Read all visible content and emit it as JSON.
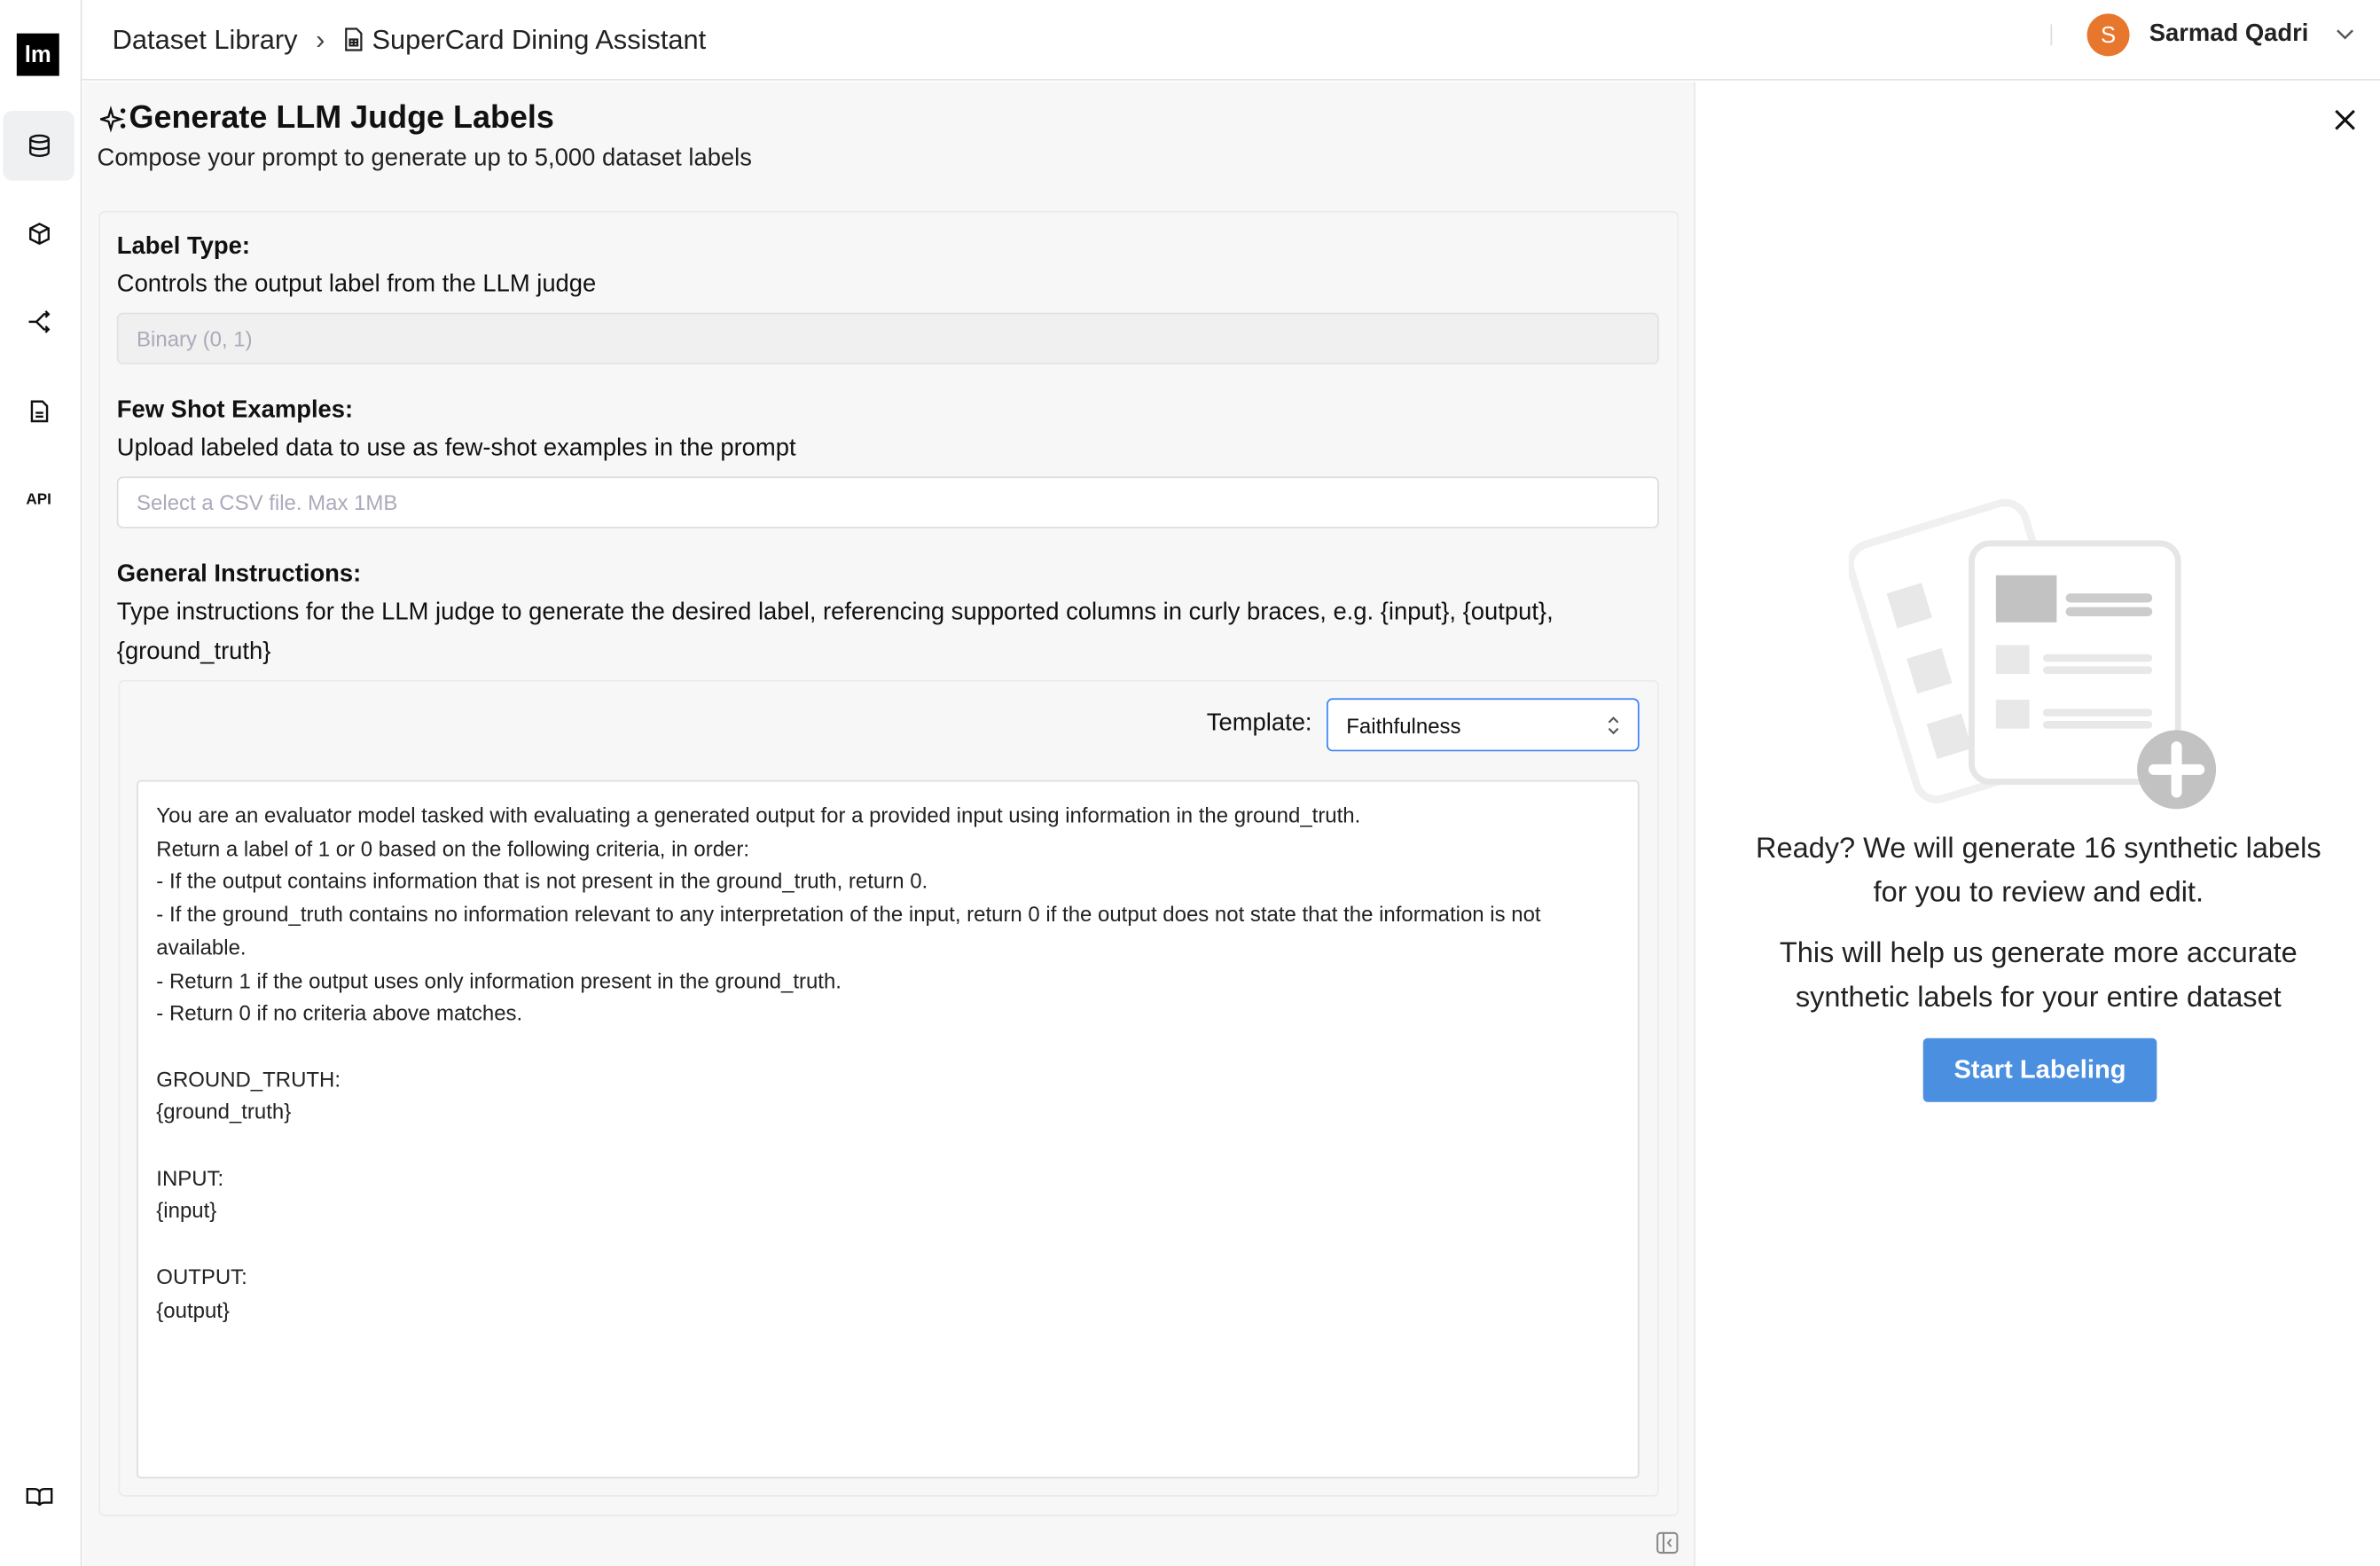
{
  "sidebar": {
    "logo": "lm",
    "items": [
      {
        "icon": "database-icon",
        "active": true
      },
      {
        "icon": "cube-icon"
      },
      {
        "icon": "branch-icon"
      },
      {
        "icon": "document-icon"
      },
      {
        "icon": "api-icon",
        "label": "API"
      }
    ],
    "bottom_icon": "book-icon"
  },
  "header": {
    "breadcrumb": [
      "Dataset Library",
      "SuperCard Dining Assistant"
    ],
    "user": {
      "initial": "S",
      "name": "Sarmad Qadri",
      "avatar_color": "#e8772e"
    }
  },
  "main": {
    "title": "Generate LLM Judge Labels",
    "subtitle": "Compose your prompt to generate up to 5,000 dataset labels",
    "label_type": {
      "label": "Label Type:",
      "description": "Controls the output label from the LLM judge",
      "placeholder": "Binary (0, 1)"
    },
    "few_shot": {
      "label": "Few Shot Examples:",
      "description": "Upload labeled data to use as few-shot examples in the prompt",
      "placeholder": "Select a CSV file. Max 1MB"
    },
    "instructions": {
      "label": "General Instructions:",
      "description": "Type instructions for the LLM judge to generate the desired label, referencing supported columns in curly braces, e.g. {input}, {output}, {ground_truth}",
      "template_label": "Template:",
      "template_value": "Faithfulness",
      "prompt": "You are an evaluator model tasked with evaluating a generated output for a provided input using information in the ground_truth.\nReturn a label of 1 or 0 based on the following criteria, in order:\n- If the output contains information that is not present in the ground_truth, return 0.\n- If the ground_truth contains no information relevant to any interpretation of the input, return 0 if the output does not state that the information is not available.\n- Return 1 if the output uses only information present in the ground_truth.\n- Return 0 if no criteria above matches.\n\nGROUND_TRUTH:\n{ground_truth}\n\nINPUT:\n{input}\n\nOUTPUT:\n{output}"
    }
  },
  "right": {
    "ready_text": "Ready? We will generate 16 synthetic labels for you to review and edit.",
    "help_text": "This will help us generate more accurate synthetic labels for your entire dataset",
    "button": "Start Labeling",
    "accent": "#4a8fe0"
  }
}
